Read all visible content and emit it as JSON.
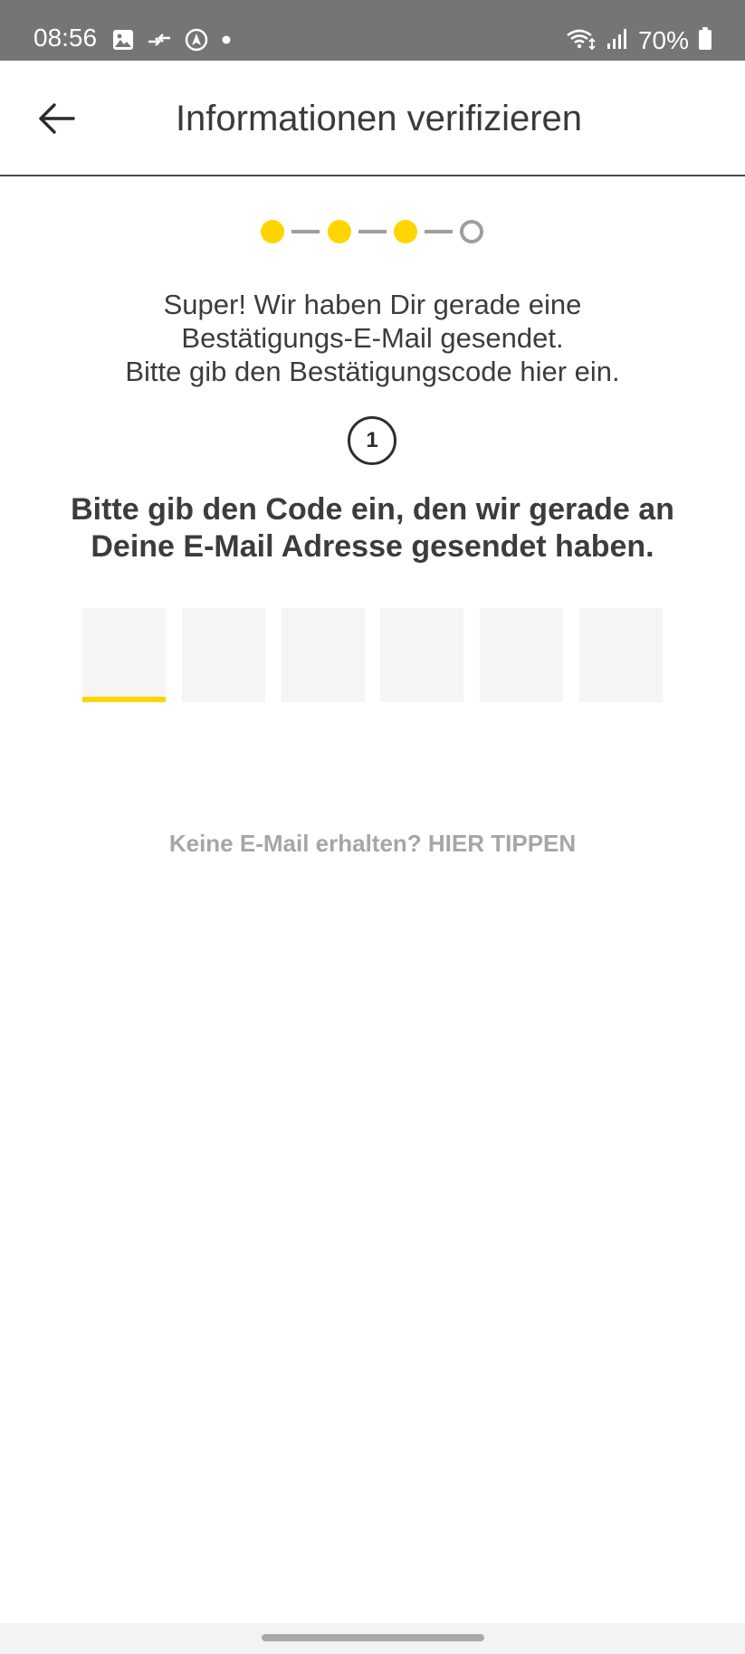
{
  "status_bar": {
    "time": "08:56",
    "battery": "70%",
    "icons_left": [
      "image-icon",
      "transfer-icon",
      "navigation-icon",
      "dot-icon"
    ],
    "icons_right": [
      "wifi-icon",
      "signal-icon",
      "battery-icon"
    ]
  },
  "app_bar": {
    "title": "Informationen verifizieren",
    "back_icon": "arrow-left-icon"
  },
  "stepper": {
    "total_steps": 4,
    "completed_steps": 3,
    "active_color": "#FFD500",
    "inactive_color": "#9E9E9E"
  },
  "intro": {
    "lines": [
      "Super! Wir haben Dir gerade eine",
      "Bestätigungs-E-Mail gesendet.",
      "Bitte gib den Bestätigungscode hier ein."
    ]
  },
  "step_number": "1",
  "instruction": "Bitte gib den Code ein, den wir gerade an Deine E-Mail Adresse gesendet haben.",
  "code_input": {
    "length": 6,
    "values": [
      "",
      "",
      "",
      "",
      "",
      ""
    ],
    "active_index": 0,
    "accent_color": "#FFD500"
  },
  "resend": {
    "text": "Keine E-Mail erhalten? HIER TIPPEN"
  }
}
